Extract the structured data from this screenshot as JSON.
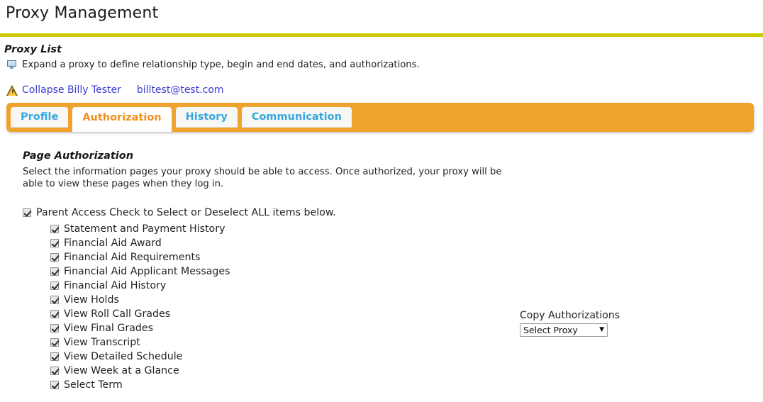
{
  "page": {
    "title": "Proxy Management"
  },
  "proxy_list": {
    "heading": "Proxy List",
    "hint": "Expand a proxy to define relationship type, begin and end dates, and authorizations.",
    "hint_icon": "screen-callout-icon",
    "warning_icon": "warning-triangle-icon",
    "collapse_link": "Collapse Billy Tester",
    "email_link": "billtest@test.com"
  },
  "tabs": [
    {
      "label": "Profile",
      "active": false
    },
    {
      "label": "Authorization",
      "active": true
    },
    {
      "label": "History",
      "active": false
    },
    {
      "label": "Communication",
      "active": false
    }
  ],
  "page_authorization": {
    "heading": "Page Authorization",
    "description": "Select the information pages your proxy should be able to access. Once authorized, your proxy will be able to view these pages when they log in.",
    "parent_checkbox": {
      "label": "Parent Access Check to Select or Deselect ALL items below.",
      "checked": true
    },
    "items": [
      {
        "label": "Statement and Payment History",
        "checked": true
      },
      {
        "label": "Financial Aid Award",
        "checked": true
      },
      {
        "label": "Financial Aid Requirements",
        "checked": true
      },
      {
        "label": "Financial Aid Applicant Messages",
        "checked": true
      },
      {
        "label": "Financial Aid History",
        "checked": true
      },
      {
        "label": "View Holds",
        "checked": true
      },
      {
        "label": "View Roll Call Grades",
        "checked": true
      },
      {
        "label": "View Final Grades",
        "checked": true
      },
      {
        "label": "View Transcript",
        "checked": true
      },
      {
        "label": "View Detailed Schedule",
        "checked": true
      },
      {
        "label": "View Week at a Glance",
        "checked": true
      },
      {
        "label": "Select Term",
        "checked": true
      }
    ]
  },
  "copy_authorizations": {
    "label": "Copy Authorizations",
    "select_value": "Select Proxy",
    "caret_icon": "chevron-down-icon"
  },
  "colors": {
    "rule_yellow": "#cccc00",
    "tab_orange": "#f0a22f",
    "active_tab_text": "#f0901c",
    "tab_text_blue": "#36a8e0",
    "link_blue": "#3a3ad6"
  }
}
